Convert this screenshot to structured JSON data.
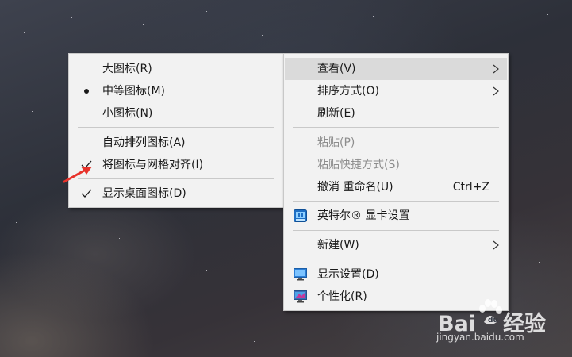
{
  "view_submenu": {
    "items": [
      {
        "label": "大图标(R)",
        "mark": "none"
      },
      {
        "label": "中等图标(M)",
        "mark": "bullet"
      },
      {
        "label": "小图标(N)",
        "mark": "none"
      },
      {
        "label": "自动排列图标(A)",
        "mark": "none"
      },
      {
        "label": "将图标与网格对齐(I)",
        "mark": "check"
      },
      {
        "label": "显示桌面图标(D)",
        "mark": "check"
      }
    ]
  },
  "context_menu": {
    "view": "查看(V)",
    "sort_by": "排序方式(O)",
    "refresh": "刷新(E)",
    "paste": "粘贴(P)",
    "paste_shortcut": "粘贴快捷方式(S)",
    "undo_rename": "撤消 重命名(U)",
    "undo_rename_shortcut": "Ctrl+Z",
    "intel_graphics": "英特尔® 显卡设置",
    "new": "新建(W)",
    "display_settings": "显示设置(D)",
    "personalize": "个性化(R)"
  },
  "watermark": {
    "logo": "Bai",
    "logo_suffix": "经验",
    "url": "jingyan.baidu.com"
  },
  "icons": {
    "submenu_arrow": "chevron-right-icon",
    "checked": "checkmark-icon",
    "radio_selected": "bullet-icon",
    "intel": "intel-graphics-icon",
    "display": "monitor-icon",
    "personalize": "personalize-monitor-icon",
    "annotation": "red-arrow-icon"
  },
  "colors": {
    "menu_bg": "#f2f2f2",
    "menu_highlight": "#dadada",
    "disabled_text": "#8d8d8d",
    "annotation_red": "#e8332b"
  }
}
